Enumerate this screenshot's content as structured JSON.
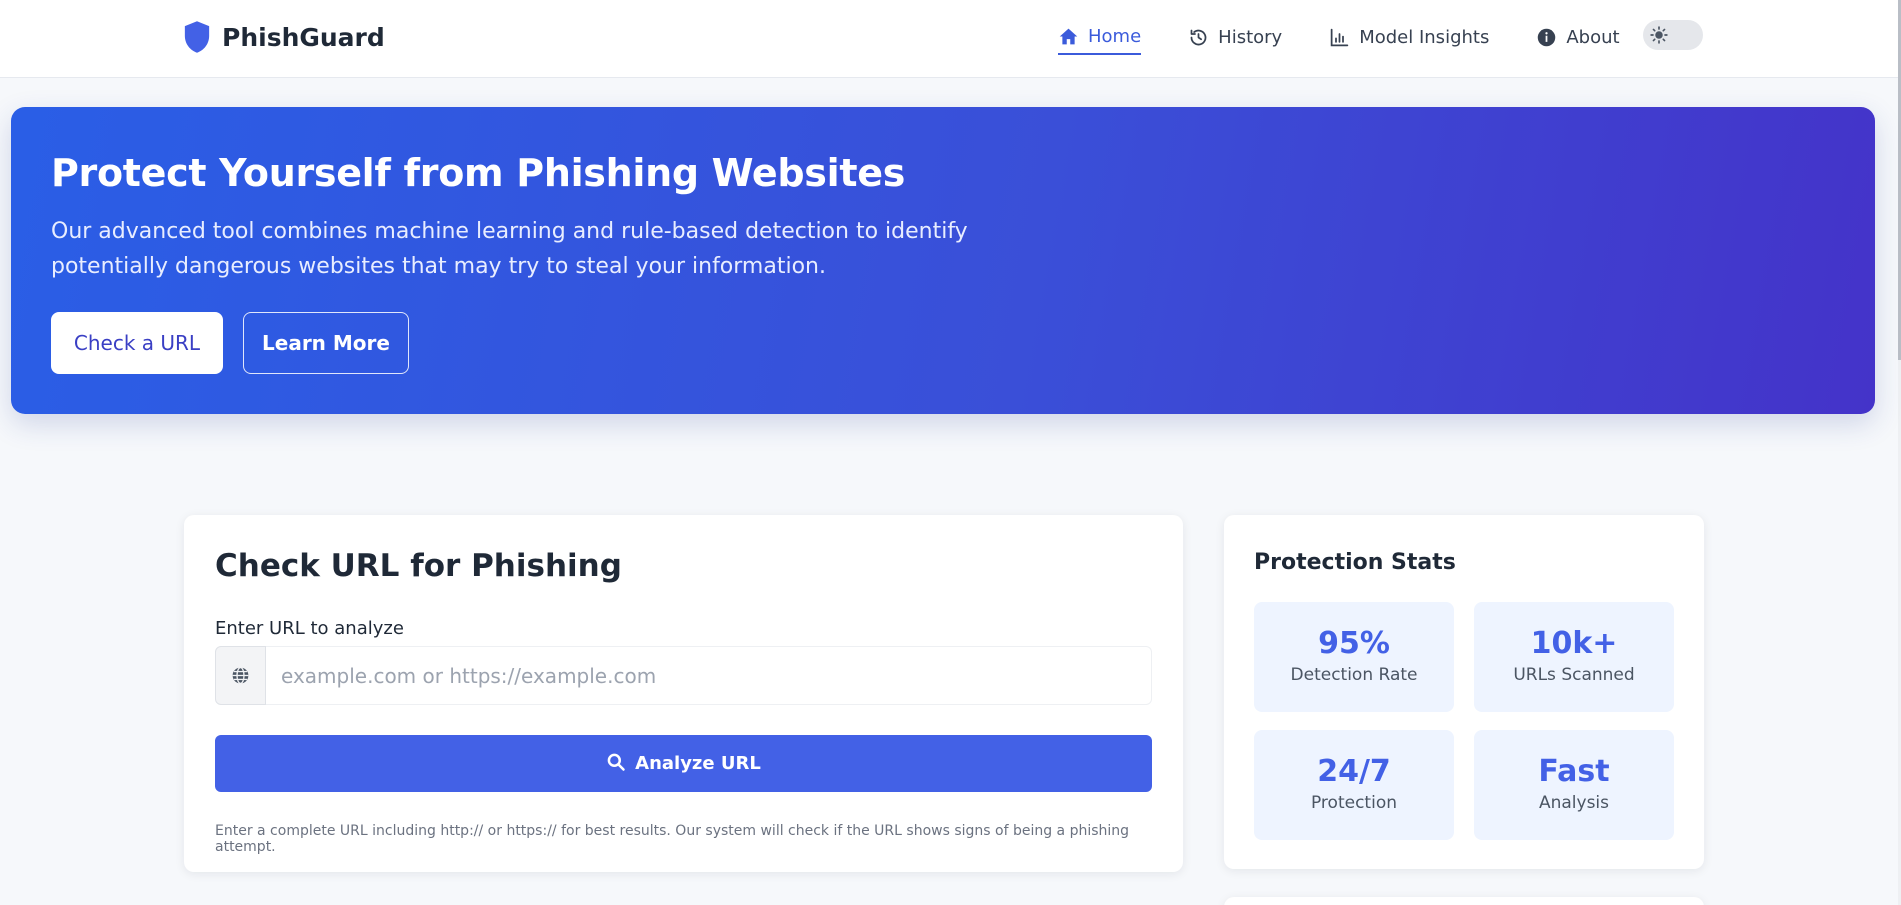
{
  "brand": {
    "name": "PhishGuard"
  },
  "nav": {
    "items": [
      {
        "label": "Home",
        "icon": "home-icon",
        "active": true
      },
      {
        "label": "History",
        "icon": "history-icon",
        "active": false
      },
      {
        "label": "Model Insights",
        "icon": "chart-icon",
        "active": false
      },
      {
        "label": "About",
        "icon": "info-icon",
        "active": false
      }
    ],
    "theme_toggle_icon": "sun-icon"
  },
  "hero": {
    "title": "Protect Yourself from Phishing Websites",
    "description": "Our advanced tool combines machine learning and rule-based detection to identify potentially dangerous websites that may try to steal your information.",
    "primary_button": "Check a URL",
    "secondary_button": "Learn More"
  },
  "check": {
    "title": "Check URL for Phishing",
    "label": "Enter URL to analyze",
    "placeholder": "example.com or https://example.com",
    "value": "",
    "button": "Analyze URL",
    "help": "Enter a complete URL including http:// or https:// for best results. Our system will check if the URL shows signs of being a phishing attempt."
  },
  "stats": {
    "title": "Protection Stats",
    "items": [
      {
        "value": "95%",
        "label": "Detection Rate"
      },
      {
        "value": "10k+",
        "label": "URLs Scanned"
      },
      {
        "value": "24/7",
        "label": "Protection"
      },
      {
        "value": "Fast",
        "label": "Analysis"
      }
    ]
  },
  "colors": {
    "accent": "#4361e6",
    "hero_start": "#2a5ee6",
    "hero_end": "#4433c9"
  }
}
